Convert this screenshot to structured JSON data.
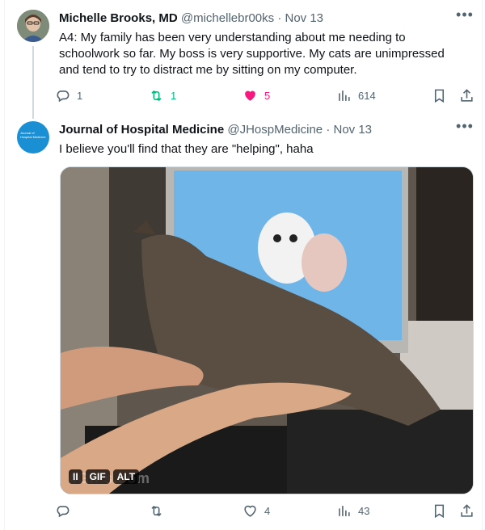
{
  "tweets": [
    {
      "author_name": "Michelle Brooks, MD",
      "handle": "@michellebr00ks",
      "separator": "·",
      "date": "Nov 13",
      "text": "A4: My family has been very understanding about me needing to schoolwork so far. My boss is very supportive. My cats are unimpressed and tend to try to distract me by sitting on my computer.",
      "replies": "1",
      "retweets": "1",
      "likes": "5",
      "views": "614",
      "retweeted": true,
      "liked": true
    },
    {
      "author_name": "Journal of Hospital Medicine",
      "handle": "@JHospMedicine",
      "separator": "·",
      "date": "Nov 13",
      "text": "I believe you'll find that they are \"helping\", haha",
      "avatar_text": "Journal of Hospital Medicine",
      "media": {
        "gif_label": "GIF",
        "alt_label": "ALT",
        "pause_label": "II",
        "watermark": "4GIFs.com"
      },
      "replies": "",
      "retweets": "",
      "likes": "4",
      "views": "43",
      "retweeted": false,
      "liked": false
    }
  ],
  "colors": {
    "accent": "#1d9bf0",
    "retweet_active": "#00ba7c",
    "like_active": "#f91880",
    "muted": "#536471"
  },
  "icons": [
    "reply-icon",
    "retweet-icon",
    "like-icon",
    "views-icon",
    "bookmark-icon",
    "share-icon",
    "more-icon"
  ]
}
